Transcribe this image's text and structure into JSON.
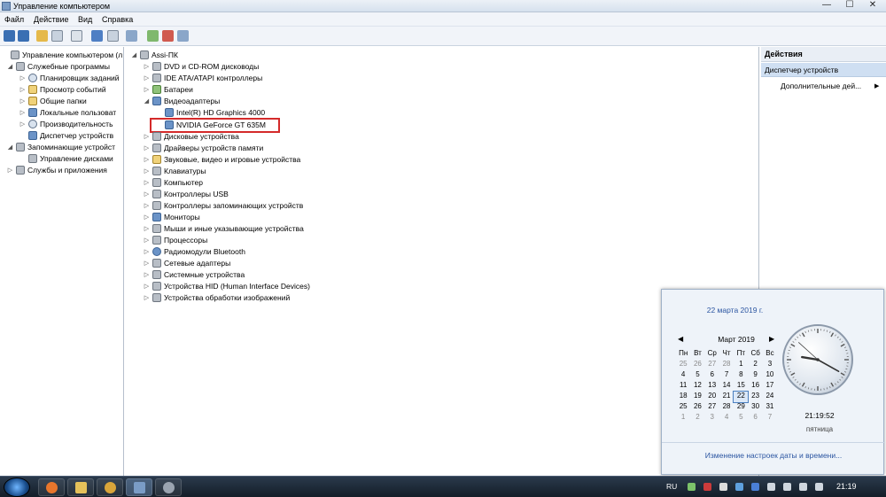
{
  "window": {
    "title": "Управление компьютером",
    "min": "—",
    "max": "☐",
    "close": "✕"
  },
  "menu": [
    "Файл",
    "Действие",
    "Вид",
    "Справка"
  ],
  "left_tree": [
    {
      "label": "Управление компьютером (л",
      "depth": 0,
      "exp": ""
    },
    {
      "label": "Служебные программы",
      "depth": 1,
      "exp": "◢"
    },
    {
      "label": "Планировщик заданий",
      "depth": 2,
      "exp": "▷"
    },
    {
      "label": "Просмотр событий",
      "depth": 2,
      "exp": "▷"
    },
    {
      "label": "Общие папки",
      "depth": 2,
      "exp": "▷"
    },
    {
      "label": "Локальные пользоват",
      "depth": 2,
      "exp": "▷"
    },
    {
      "label": "Производительность",
      "depth": 2,
      "exp": "▷"
    },
    {
      "label": "Диспетчер устройств",
      "depth": 2,
      "exp": ""
    },
    {
      "label": "Запоминающие устройст",
      "depth": 1,
      "exp": "◢"
    },
    {
      "label": "Управление дисками",
      "depth": 2,
      "exp": ""
    },
    {
      "label": "Службы и приложения",
      "depth": 1,
      "exp": "▷"
    }
  ],
  "device_tree": {
    "root": "Assi-ПК",
    "items": [
      {
        "label": "DVD и CD-ROM дисководы",
        "depth": 1,
        "exp": "▷"
      },
      {
        "label": "IDE ATA/ATAPI контроллеры",
        "depth": 1,
        "exp": "▷"
      },
      {
        "label": "Батареи",
        "depth": 1,
        "exp": "▷"
      },
      {
        "label": "Видеоадаптеры",
        "depth": 1,
        "exp": "◢"
      },
      {
        "label": "Intel(R) HD Graphics 4000",
        "depth": 2,
        "exp": ""
      },
      {
        "label": "NVIDIA GeForce GT 635M",
        "depth": 2,
        "exp": ""
      },
      {
        "label": "Дисковые устройства",
        "depth": 1,
        "exp": "▷"
      },
      {
        "label": "Драйверы устройств памяти",
        "depth": 1,
        "exp": "▷"
      },
      {
        "label": "Звуковые, видео и игровые устройства",
        "depth": 1,
        "exp": "▷"
      },
      {
        "label": "Клавиатуры",
        "depth": 1,
        "exp": "▷"
      },
      {
        "label": "Компьютер",
        "depth": 1,
        "exp": "▷"
      },
      {
        "label": "Контроллеры USB",
        "depth": 1,
        "exp": "▷"
      },
      {
        "label": "Контроллеры запоминающих устройств",
        "depth": 1,
        "exp": "▷"
      },
      {
        "label": "Мониторы",
        "depth": 1,
        "exp": "▷"
      },
      {
        "label": "Мыши и иные указывающие устройства",
        "depth": 1,
        "exp": "▷"
      },
      {
        "label": "Процессоры",
        "depth": 1,
        "exp": "▷"
      },
      {
        "label": "Радиомодули Bluetooth",
        "depth": 1,
        "exp": "▷"
      },
      {
        "label": "Сетевые адаптеры",
        "depth": 1,
        "exp": "▷"
      },
      {
        "label": "Системные устройства",
        "depth": 1,
        "exp": "▷"
      },
      {
        "label": "Устройства HID (Human Interface Devices)",
        "depth": 1,
        "exp": "▷"
      },
      {
        "label": "Устройства обработки изображений",
        "depth": 1,
        "exp": "▷"
      }
    ]
  },
  "actions": {
    "header": "Действия",
    "selected": "Диспетчер устройств",
    "more": "Дополнительные дей...",
    "arrow": "▶"
  },
  "calendar": {
    "date_header": "22 марта 2019 г.",
    "month": "Март 2019",
    "prev": "◀",
    "next": "▶",
    "weekdays": [
      "Пн",
      "Вт",
      "Ср",
      "Чт",
      "Пт",
      "Сб",
      "Вс"
    ],
    "weeks": [
      [
        "25",
        "26",
        "27",
        "28",
        "1",
        "2",
        "3"
      ],
      [
        "4",
        "5",
        "6",
        "7",
        "8",
        "9",
        "10"
      ],
      [
        "11",
        "12",
        "13",
        "14",
        "15",
        "16",
        "17"
      ],
      [
        "18",
        "19",
        "20",
        "21",
        "22",
        "23",
        "24"
      ],
      [
        "25",
        "26",
        "27",
        "28",
        "29",
        "30",
        "31"
      ],
      [
        "1",
        "2",
        "3",
        "4",
        "5",
        "6",
        "7"
      ]
    ],
    "today": "22",
    "time": "21:19:52",
    "weekday_name": "пятница",
    "settings_link": "Изменение настроек даты и времени..."
  },
  "taskbar": {
    "lang": "RU",
    "time": "21:19"
  },
  "colors": {
    "highlight_border": "#d42a2a",
    "link": "#2b55a1"
  }
}
